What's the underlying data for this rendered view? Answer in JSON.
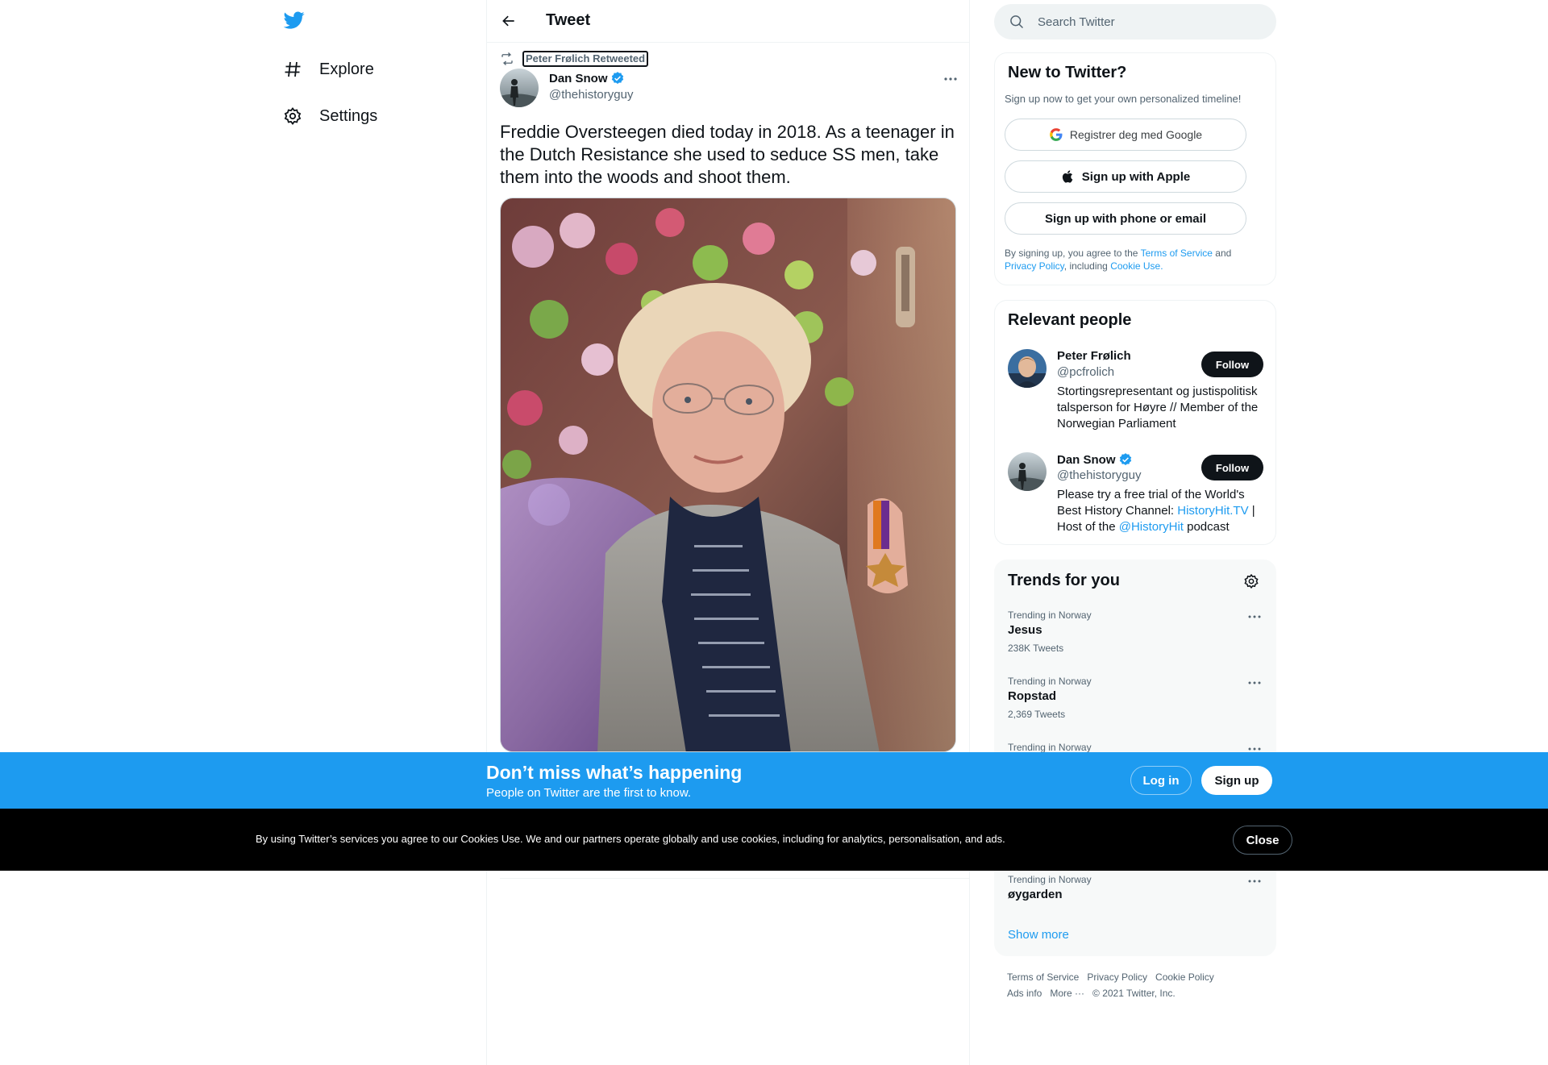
{
  "nav": {
    "logo_icon": "twitter-bird-icon",
    "items": [
      {
        "label": "Explore",
        "icon": "hashtag-icon"
      },
      {
        "label": "Settings",
        "icon": "gear-icon"
      }
    ]
  },
  "header": {
    "title": "Tweet",
    "back_icon": "arrow-left-icon"
  },
  "tweet": {
    "retweeted_by": "Peter Frølich Retweeted",
    "author_name": "Dan Snow",
    "author_handle": "@thehistoryguy",
    "text": "Freddie Oversteegen died today in 2018. As a teenager in the Dutch Resistance she used to seduce SS men, take them into the woods and shoot them.",
    "media_icon": "photo-elderly-woman-with-medal"
  },
  "search": {
    "placeholder": "Search Twitter"
  },
  "signup_card": {
    "title": "New to Twitter?",
    "subtitle": "Sign up now to get your own personalized timeline!",
    "google_label": "Registrer deg med Google",
    "apple_label": "Sign up with Apple",
    "phone_label": "Sign up with phone or email",
    "terms_prefix": "By signing up, you agree to the",
    "terms_link": "Terms of Service",
    "terms_and": "and",
    "privacy_link": "Privacy Policy",
    "including": ", including",
    "cookie_link": "Cookie Use."
  },
  "people": {
    "title": "Relevant people",
    "list": [
      {
        "name": "Peter Frølich",
        "handle": "@pcfrolich",
        "bio": "Stortingsrepresentant og justispolitisk talsperson for Høyre // Member of the Norwegian Parliament",
        "follow_label": "Follow"
      },
      {
        "name": "Dan Snow",
        "handle": "@thehistoryguy",
        "bio_prefix": "Please try a free trial of the World's Best History Channel: ",
        "bio_link": "HistoryHit.TV",
        "bio_mid": " | Host of the ",
        "bio_mention": "@HistoryHit",
        "bio_suffix": " podcast",
        "follow_label": "Follow"
      }
    ]
  },
  "trends": {
    "title": "Trends for you",
    "items": [
      {
        "context": "Trending in Norway",
        "name": "Jesus",
        "count": "238K Tweets"
      },
      {
        "context": "Trending in Norway",
        "name": "Ropstad",
        "count": "2,369 Tweets"
      },
      {
        "context": "Trending in Norway",
        "name": "",
        "count": ""
      },
      {
        "context": "Trending in Norway",
        "name": "øygarden",
        "count": ""
      }
    ],
    "show_more": "Show more"
  },
  "footer": {
    "links": [
      "Terms of Service",
      "Privacy Policy",
      "Cookie Policy",
      "Ads info",
      "More ···",
      "© 2021 Twitter, Inc."
    ]
  },
  "promo": {
    "title": "Don’t miss what’s happening",
    "subtitle": "People on Twitter are the first to know.",
    "login_label": "Log in",
    "signup_label": "Sign up"
  },
  "cookie": {
    "text": "By using Twitter’s services you agree to our Cookies Use. We and our partners operate globally and use cookies, including for analytics, personalisation, and ads.",
    "close_label": "Close"
  },
  "colors": {
    "brand": "#1d9bf0",
    "text_primary": "#0f1419",
    "text_secondary": "#536471",
    "cookie_bg": "#000000"
  }
}
